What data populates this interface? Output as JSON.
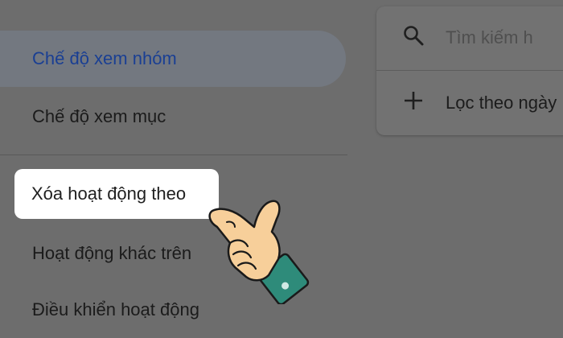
{
  "sidebar": {
    "items": [
      {
        "label": "Chế độ xem nhóm"
      },
      {
        "label": "Chế độ xem mục"
      },
      {
        "label": "Xóa hoạt động theo"
      },
      {
        "label": "Hoạt động khác trên"
      },
      {
        "label": "Điều khiển hoạt động"
      }
    ]
  },
  "search": {
    "placeholder": "Tìm kiếm h",
    "filter_label": "Lọc theo ngày"
  },
  "icons": {
    "search": "search-icon",
    "add": "plus-icon",
    "pointer": "pointing-hand-icon"
  },
  "colors": {
    "active_text": "#1a3f93",
    "active_bg": "#737880",
    "highlight": "#ffffff",
    "cuff": "#2e8b7a"
  }
}
